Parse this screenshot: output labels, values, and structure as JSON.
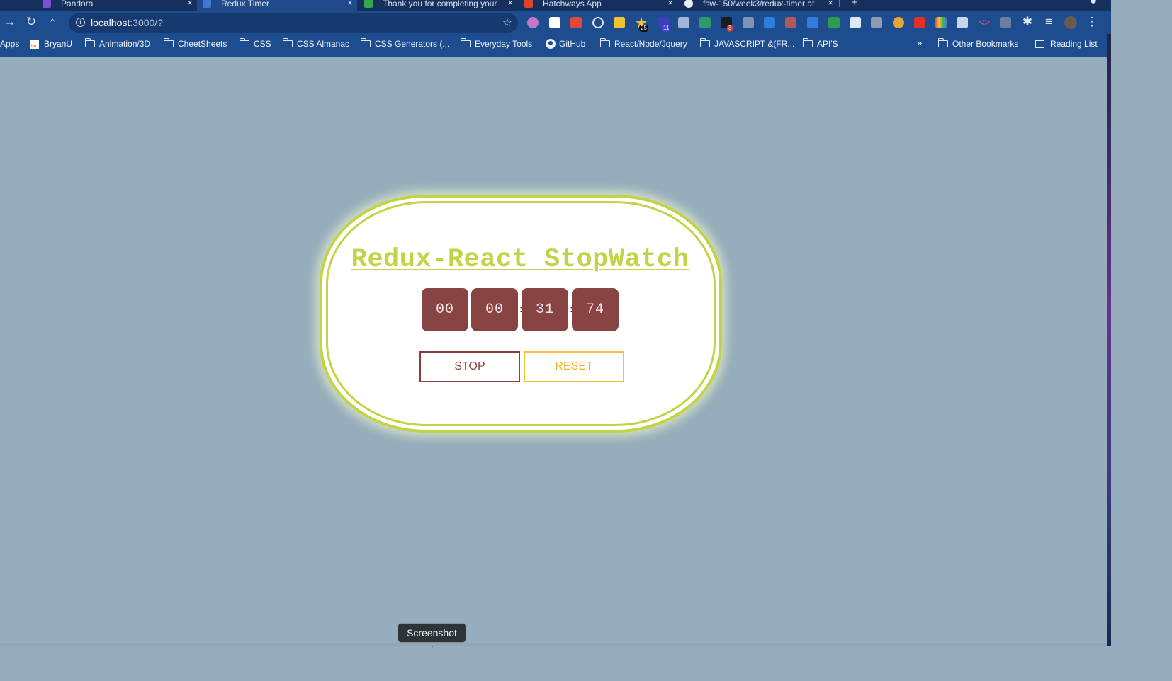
{
  "browser": {
    "tabs": [
      {
        "title": "Pandora",
        "active": false
      },
      {
        "title": "Redux Timer",
        "active": true
      },
      {
        "title": "Thank you for completing your",
        "active": false
      },
      {
        "title": "Hatchways App",
        "active": false
      },
      {
        "title": "fsw-150/week3/redux-timer at",
        "active": false
      }
    ],
    "url_host": "localhost",
    "url_rest": ":3000/?",
    "bookmarks": {
      "apps": "Apps",
      "items": [
        "BryanU",
        "Animation/3D",
        "CheetSheets",
        "CSS",
        "CSS Almanac",
        "CSS Generators (...",
        "Everyday  Tools",
        "GitHub",
        "React/Node/Jquery",
        "JAVASCRIPT &(FR...",
        "API'S"
      ],
      "more": "»",
      "other": "Other Bookmarks",
      "reading": "Reading List"
    },
    "extension_badges": {
      "star": "25",
      "blue": "11",
      "b": "3"
    }
  },
  "app": {
    "title": "Redux-React StopWatch",
    "time": {
      "hours": "00",
      "minutes": "00",
      "seconds": "31",
      "centiseconds": "74"
    },
    "separator": ":",
    "stop_label": "STOP",
    "reset_label": "RESET",
    "colors": {
      "accent": "#c3d348",
      "digit_bg": "#884343",
      "stop": "#8a3d3d",
      "reset": "#f0b428",
      "page_bg": "#95adbc"
    }
  },
  "tooltip": "Screenshot"
}
